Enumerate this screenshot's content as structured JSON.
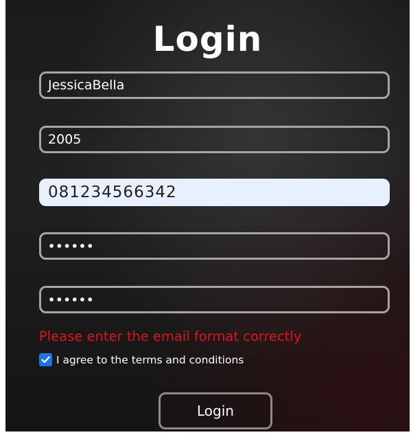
{
  "form": {
    "title": "Login",
    "fields": [
      {
        "name": "username",
        "value": "JessicaBella"
      },
      {
        "name": "year",
        "value": "2005"
      },
      {
        "name": "phone",
        "value": "081234566342"
      },
      {
        "name": "password",
        "value": "••••••"
      },
      {
        "name": "confirm_password",
        "value": "••••••"
      }
    ],
    "error_message": "Please enter the email format correctly",
    "terms_label": "I agree to the terms and conditions",
    "terms_checked": true,
    "login_button": "Login"
  },
  "colors": {
    "error": "#e0141d",
    "checkbox": "#1a73e8",
    "autofill_bg": "#e8f0fe"
  },
  "icons": {
    "checkbox": "check-icon"
  }
}
